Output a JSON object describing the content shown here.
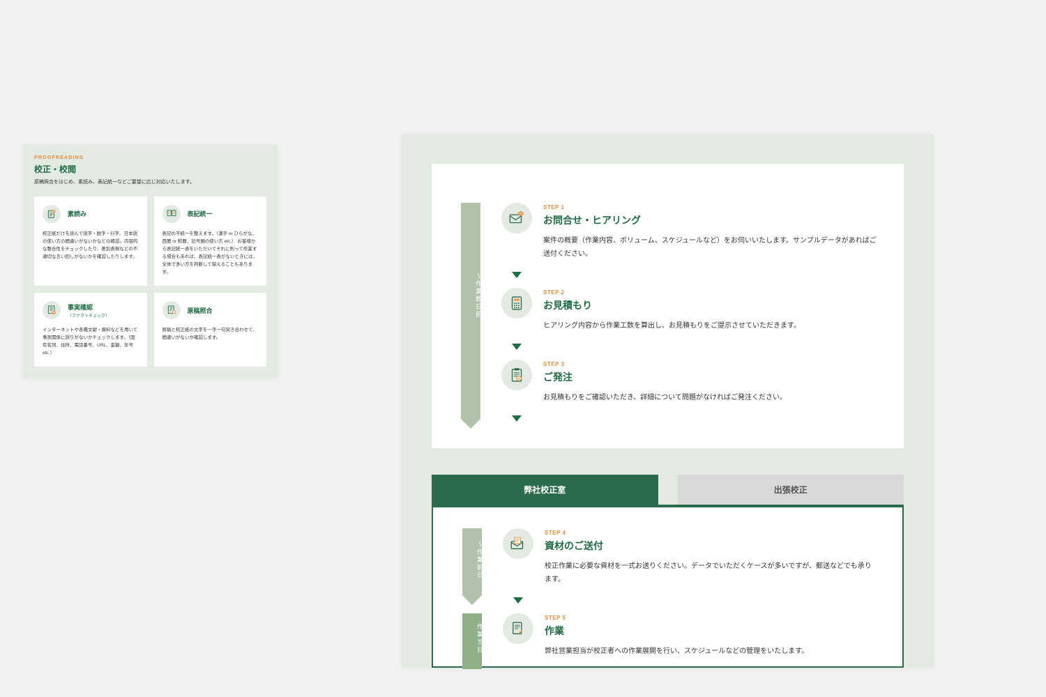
{
  "left": {
    "eyebrow": "PROOFREADING",
    "title": "校正・校閲",
    "lead": "原稿照合をはじめ、素読み、表記統一などご要望に応じ対応いたします。",
    "cards": [
      {
        "title": "素読み",
        "sub": "",
        "desc": "校正紙だけを読んで誤字・脱字・衍字、日本語の使い方の間違いがないかなどの確認。内容的な整合性をチェックしたり、差別表現などの不適切な言い回しがないかを確認したりします。"
      },
      {
        "title": "表記統一",
        "sub": "",
        "desc": "表記の不統一を整えます。（漢字 or ひらがな、西暦 or 和暦、記号類の使い方 etc.）\nお客様から表記統一表をいただいてそれに則って作業する場合もあれば、表記統一表がないときには、全体で多い方を判断して揃えることもあります。"
      },
      {
        "title": "事実確認",
        "sub": "（ファクトチェック）",
        "desc": "インターネットや各種文献・資料などを用いて事実関係に誤りがないかチェックします。（固有名詞、住所、電話番号、URL、金額、年号 etc.）"
      },
      {
        "title": "原稿照合",
        "sub": "",
        "desc": "原稿と校正紙の文字を一字一句突き合わせて、間違いがないか確認します。"
      }
    ]
  },
  "right": {
    "timeline_label": "〜作業数日前",
    "steps": [
      {
        "label": "STEP 1",
        "title": "お問合せ・ヒアリング",
        "desc": "案件の概要（作業内容、ボリューム、スケジュールなど）をお伺いいたします。サンプルデータがあればご送付ください。"
      },
      {
        "label": "STEP 2",
        "title": "お見積もり",
        "desc": "ヒアリング内容から作業工数を算出し、お見積もりをご提示させていただきます。"
      },
      {
        "label": "STEP 3",
        "title": "ご発注",
        "desc": "お見積もりをご確認いただき、詳細について問題がなければご発注ください。"
      }
    ],
    "tabs": {
      "active": "弊社校正室",
      "inactive": "出張校正"
    },
    "timeline2a": "〜作業前日",
    "timeline2b": "作業当日",
    "steps2": [
      {
        "label": "STEP 4",
        "title": "資材のご送付",
        "desc": "校正作業に必要な資材を一式お送りください。データでいただくケースが多いですが、郵送などでも承ります。"
      },
      {
        "label": "STEP 5",
        "title": "作業",
        "desc": "弊社営業担当が校正者への作業展開を行い、スケジュールなどの管理をいたします。"
      }
    ]
  }
}
